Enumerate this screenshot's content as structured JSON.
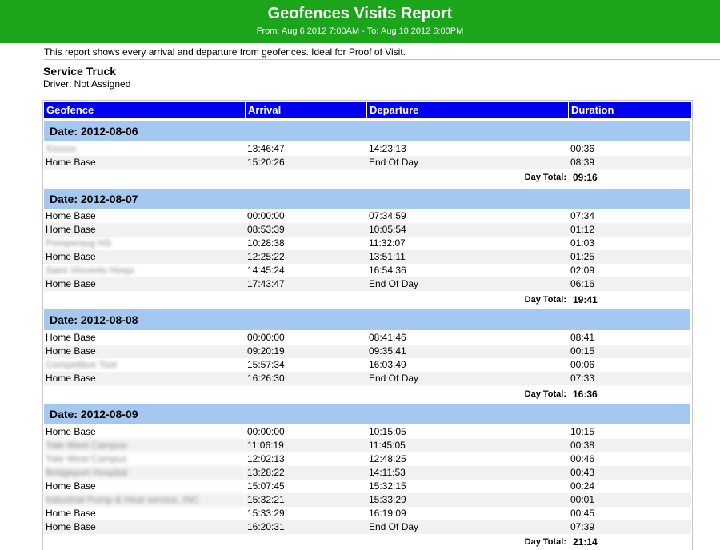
{
  "header": {
    "title": "Geofences Visits Report",
    "subtitle": "From: Aug 6 2012 7:00AM - To: Aug 10 2012 6:00PM"
  },
  "description": "This report shows every arrival and departure from geofences. Ideal for Proof of Visit.",
  "vehicle": {
    "name": "Service Truck",
    "driver": "Driver: Not Assigned"
  },
  "table": {
    "columns": [
      "Geofence",
      "Arrival",
      "Departure",
      "Duration"
    ],
    "day_total_label": "Day Total:",
    "days": [
      {
        "date": "Date: 2012-08-06",
        "rows": [
          {
            "geofence": "Xxxxxx",
            "redacted": true,
            "arrival": "13:46:47",
            "departure": "14:23:13",
            "duration": "00:36"
          },
          {
            "geofence": "Home Base",
            "redacted": false,
            "arrival": "15:20:26",
            "departure": "End Of Day",
            "duration": "08:39"
          }
        ],
        "total": "09:16"
      },
      {
        "date": "Date: 2012-08-07",
        "rows": [
          {
            "geofence": "Home Base",
            "redacted": false,
            "arrival": "00:00:00",
            "departure": "07:34:59",
            "duration": "07:34"
          },
          {
            "geofence": "Home Base",
            "redacted": false,
            "arrival": "08:53:39",
            "departure": "10:05:54",
            "duration": "01:12"
          },
          {
            "geofence": "Pomperaug HS",
            "redacted": true,
            "arrival": "10:28:38",
            "departure": "11:32:07",
            "duration": "01:03"
          },
          {
            "geofence": "Home Base",
            "redacted": false,
            "arrival": "12:25:22",
            "departure": "13:51:11",
            "duration": "01:25"
          },
          {
            "geofence": "Saint Vincents Hospi",
            "redacted": true,
            "arrival": "14:45:24",
            "departure": "16:54:36",
            "duration": "02:09"
          },
          {
            "geofence": "Home Base",
            "redacted": false,
            "arrival": "17:43:47",
            "departure": "End Of Day",
            "duration": "06:16"
          }
        ],
        "total": "19:41"
      },
      {
        "date": "Date: 2012-08-08",
        "rows": [
          {
            "geofence": "Home Base",
            "redacted": false,
            "arrival": "00:00:00",
            "departure": "08:41:46",
            "duration": "08:41"
          },
          {
            "geofence": "Home Base",
            "redacted": false,
            "arrival": "09:20:19",
            "departure": "09:35:41",
            "duration": "00:15"
          },
          {
            "geofence": "Competitive Tool",
            "redacted": true,
            "arrival": "15:57:34",
            "departure": "16:03:49",
            "duration": "00:06"
          },
          {
            "geofence": "Home Base",
            "redacted": false,
            "arrival": "16:26:30",
            "departure": "End Of Day",
            "duration": "07:33"
          }
        ],
        "total": "16:36"
      },
      {
        "date": "Date: 2012-08-09",
        "rows": [
          {
            "geofence": "Home Base",
            "redacted": false,
            "arrival": "00:00:00",
            "departure": "10:15:05",
            "duration": "10:15"
          },
          {
            "geofence": "Yale West Campus",
            "redacted": true,
            "arrival": "11:06:19",
            "departure": "11:45:05",
            "duration": "00:38"
          },
          {
            "geofence": "Yale West Campus",
            "redacted": true,
            "arrival": "12:02:13",
            "departure": "12:48:25",
            "duration": "00:46"
          },
          {
            "geofence": "Bridgeport Hospital",
            "redacted": true,
            "arrival": "13:28:22",
            "departure": "14:11:53",
            "duration": "00:43"
          },
          {
            "geofence": "Home Base",
            "redacted": false,
            "arrival": "15:07:45",
            "departure": "15:32:15",
            "duration": "00:24"
          },
          {
            "geofence": "Industrial Pump & Heat service, INC",
            "redacted": true,
            "arrival": "15:32:21",
            "departure": "15:33:29",
            "duration": "00:01"
          },
          {
            "geofence": "Home Base",
            "redacted": false,
            "arrival": "15:33:29",
            "departure": "16:19:09",
            "duration": "00:45"
          },
          {
            "geofence": "Home Base",
            "redacted": false,
            "arrival": "16:20:31",
            "departure": "End Of Day",
            "duration": "07:39"
          }
        ],
        "total": "21:14"
      }
    ]
  },
  "colors": {
    "header_green": "#1aa51a",
    "column_header_blue": "#0000ee",
    "date_bar_blue": "#a5c8f0",
    "row_alt_gray": "#f1f1f1"
  }
}
